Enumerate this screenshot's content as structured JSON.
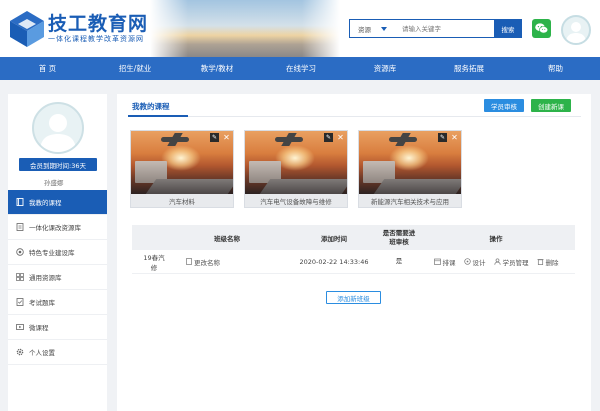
{
  "header": {
    "site_title": "技工教育网",
    "site_subtitle": "一体化课程教学改革资源网",
    "search": {
      "type_label": "资源",
      "placeholder": "请输入关键字",
      "button_label": "搜索"
    }
  },
  "nav": {
    "items": [
      "首 页",
      "招生/就业",
      "教学/教材",
      "在线学习",
      "资源库",
      "服务拓展",
      "帮助"
    ]
  },
  "sidebar": {
    "member_label": "会员到期时间:36天",
    "username": "孙盛娜",
    "menu": [
      {
        "label": "我教的课程",
        "icon": "book-icon"
      },
      {
        "label": "一体化课改资源库",
        "icon": "document-icon"
      },
      {
        "label": "特色专业建设库",
        "icon": "target-icon"
      },
      {
        "label": "通用资源库",
        "icon": "grid-icon"
      },
      {
        "label": "考试题库",
        "icon": "exam-icon"
      },
      {
        "label": "微课程",
        "icon": "video-icon"
      },
      {
        "label": "个人设置",
        "icon": "gear-icon"
      }
    ]
  },
  "main": {
    "tab_label": "我教的课程",
    "review_button": "学员审核",
    "new_course_button": "创建新课",
    "courses": [
      {
        "title": "汽车材料"
      },
      {
        "title": "汽车电气设备故障与维修"
      },
      {
        "title": "新能源汽车相关技术与应用"
      }
    ],
    "table": {
      "headers": {
        "class_name": "班级名称",
        "added_time": "添加时间",
        "review": "是否需要进班审核",
        "actions": "操作"
      },
      "rows": [
        {
          "class_name": "19春汽修",
          "rename": "更改名称",
          "added_time": "2020-02-22 14:33:46",
          "review": "是",
          "actions": {
            "schedule": "排课",
            "design": "设计",
            "students": "学员管理",
            "delete": "删除"
          }
        }
      ]
    },
    "add_class_button": "添加新班级"
  },
  "colors": {
    "brand_blue": "#1a5db5",
    "nav_blue": "#2b6cc4",
    "green": "#2db34a",
    "light_blue": "#2b8de0"
  }
}
